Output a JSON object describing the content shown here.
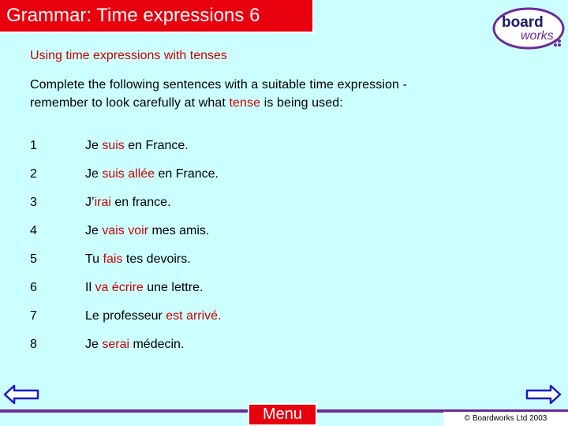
{
  "header": {
    "title": "Grammar: Time expressions 6",
    "logo": {
      "word1": "board",
      "word2": "works",
      "icon": "boardworks-logo"
    }
  },
  "subtitle": "Using time expressions with tenses",
  "instructions": {
    "line1": "Complete the following sentences with a suitable time expression -",
    "line2_before": "remember to look carefully at what ",
    "line2_highlight": "tense",
    "line2_after": " is being used:"
  },
  "sentences": [
    {
      "number": "1",
      "before": "Je ",
      "verb": "suis",
      "after": " en France."
    },
    {
      "number": "2",
      "before": "Je ",
      "verb": "suis allée",
      "after": " en France."
    },
    {
      "number": "3",
      "before": "J’",
      "verb": "irai",
      "after": " en france."
    },
    {
      "number": "4",
      "before": "Je ",
      "verb": "vais voir",
      "after": " mes amis."
    },
    {
      "number": "5",
      "before": "Tu ",
      "verb": "fais",
      "after": " tes devoirs."
    },
    {
      "number": "6",
      "before": "Il ",
      "verb": "va écrire",
      "after": " une lettre."
    },
    {
      "number": "7",
      "before": "Le professeur ",
      "verb": "est arrivé.",
      "after": ""
    },
    {
      "number": "8",
      "before": "Je ",
      "verb": "serai",
      "after": " médecin."
    }
  ],
  "footer": {
    "menu_label": "Menu",
    "copyright": "© Boardworks Ltd 2003",
    "back_icon": "arrow-left-icon",
    "forward_icon": "arrow-right-icon"
  },
  "colors": {
    "background": "#ccffff",
    "accent_red": "#e8000e",
    "text_red": "#cc0000",
    "purple": "#6c2b99",
    "arrow_blue": "#1a1acc"
  }
}
